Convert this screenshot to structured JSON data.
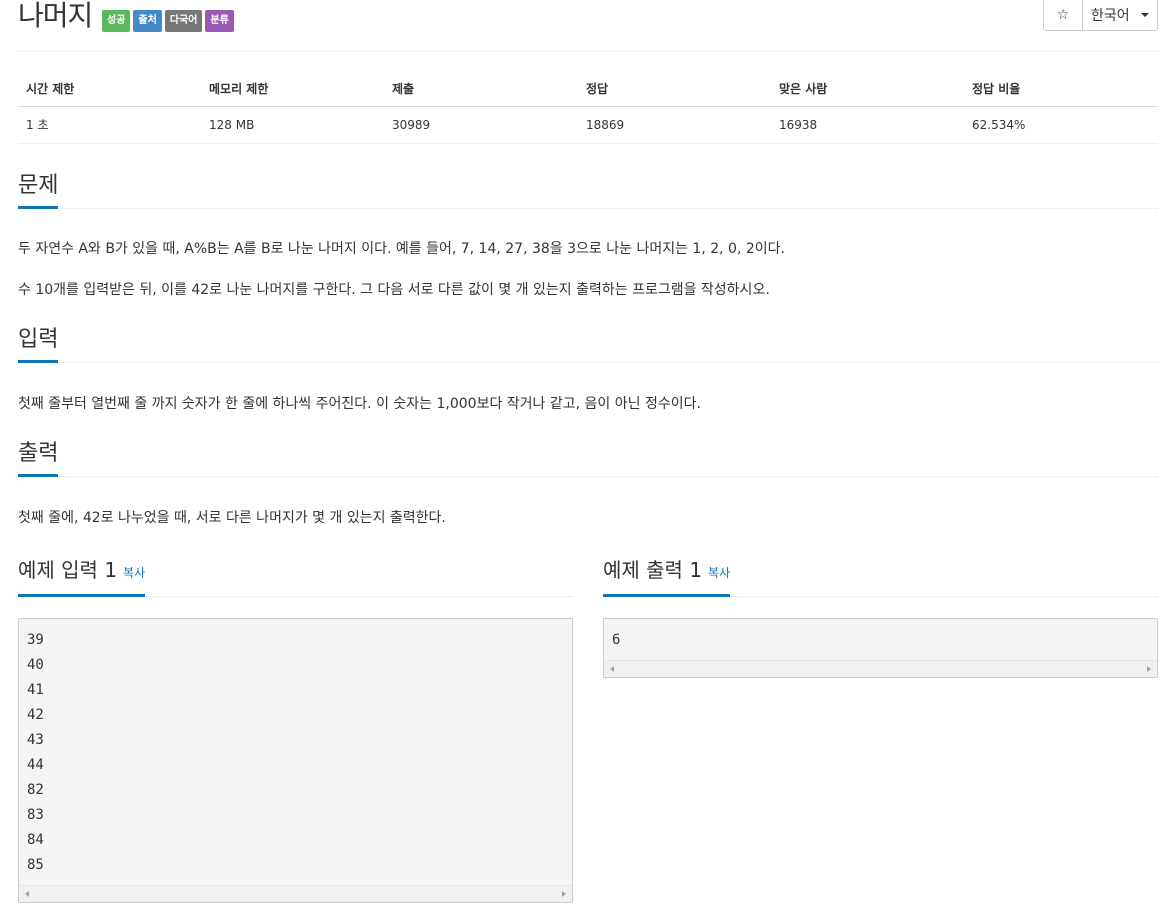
{
  "header": {
    "title": "나머지",
    "labels": {
      "success": "성공",
      "source": "출처",
      "multi": "다국어",
      "tag": "분류"
    },
    "star_icon": "☆",
    "language": "한국어"
  },
  "info_table": {
    "headers": [
      "시간 제한",
      "메모리 제한",
      "제출",
      "정답",
      "맞은 사람",
      "정답 비율"
    ],
    "values": [
      "1 초",
      "128 MB",
      "30989",
      "18869",
      "16938",
      "62.534%"
    ]
  },
  "problem": {
    "heading": "문제",
    "paragraphs": [
      "두 자연수 A와 B가 있을 때, A%B는 A를 B로 나눈 나머지 이다. 예를 들어, 7, 14, 27, 38을 3으로 나눈 나머지는 1, 2, 0, 2이다.",
      "수 10개를 입력받은 뒤, 이를 42로 나눈 나머지를 구한다. 그 다음 서로 다른 값이 몇 개 있는지 출력하는 프로그램을 작성하시오."
    ]
  },
  "input": {
    "heading": "입력",
    "text": "첫째 줄부터 열번째 줄 까지 숫자가 한 줄에 하나씩 주어진다. 이 숫자는 1,000보다 작거나 같고, 음이 아닌 정수이다."
  },
  "output": {
    "heading": "출력",
    "text": "첫째 줄에, 42로 나누었을 때, 서로 다른 나머지가 몇 개 있는지 출력한다."
  },
  "sample_input": {
    "heading": "예제 입력 1",
    "copy": "복사",
    "content": "39\n40\n41\n42\n43\n44\n82\n83\n84\n85"
  },
  "sample_output": {
    "heading": "예제 출력 1",
    "copy": "복사",
    "content": "6"
  },
  "colors": {
    "accent": "#0e76b8",
    "success": "#5cb85c",
    "source": "#428bca",
    "multi": "#777777",
    "tag": "#9b59b6"
  }
}
